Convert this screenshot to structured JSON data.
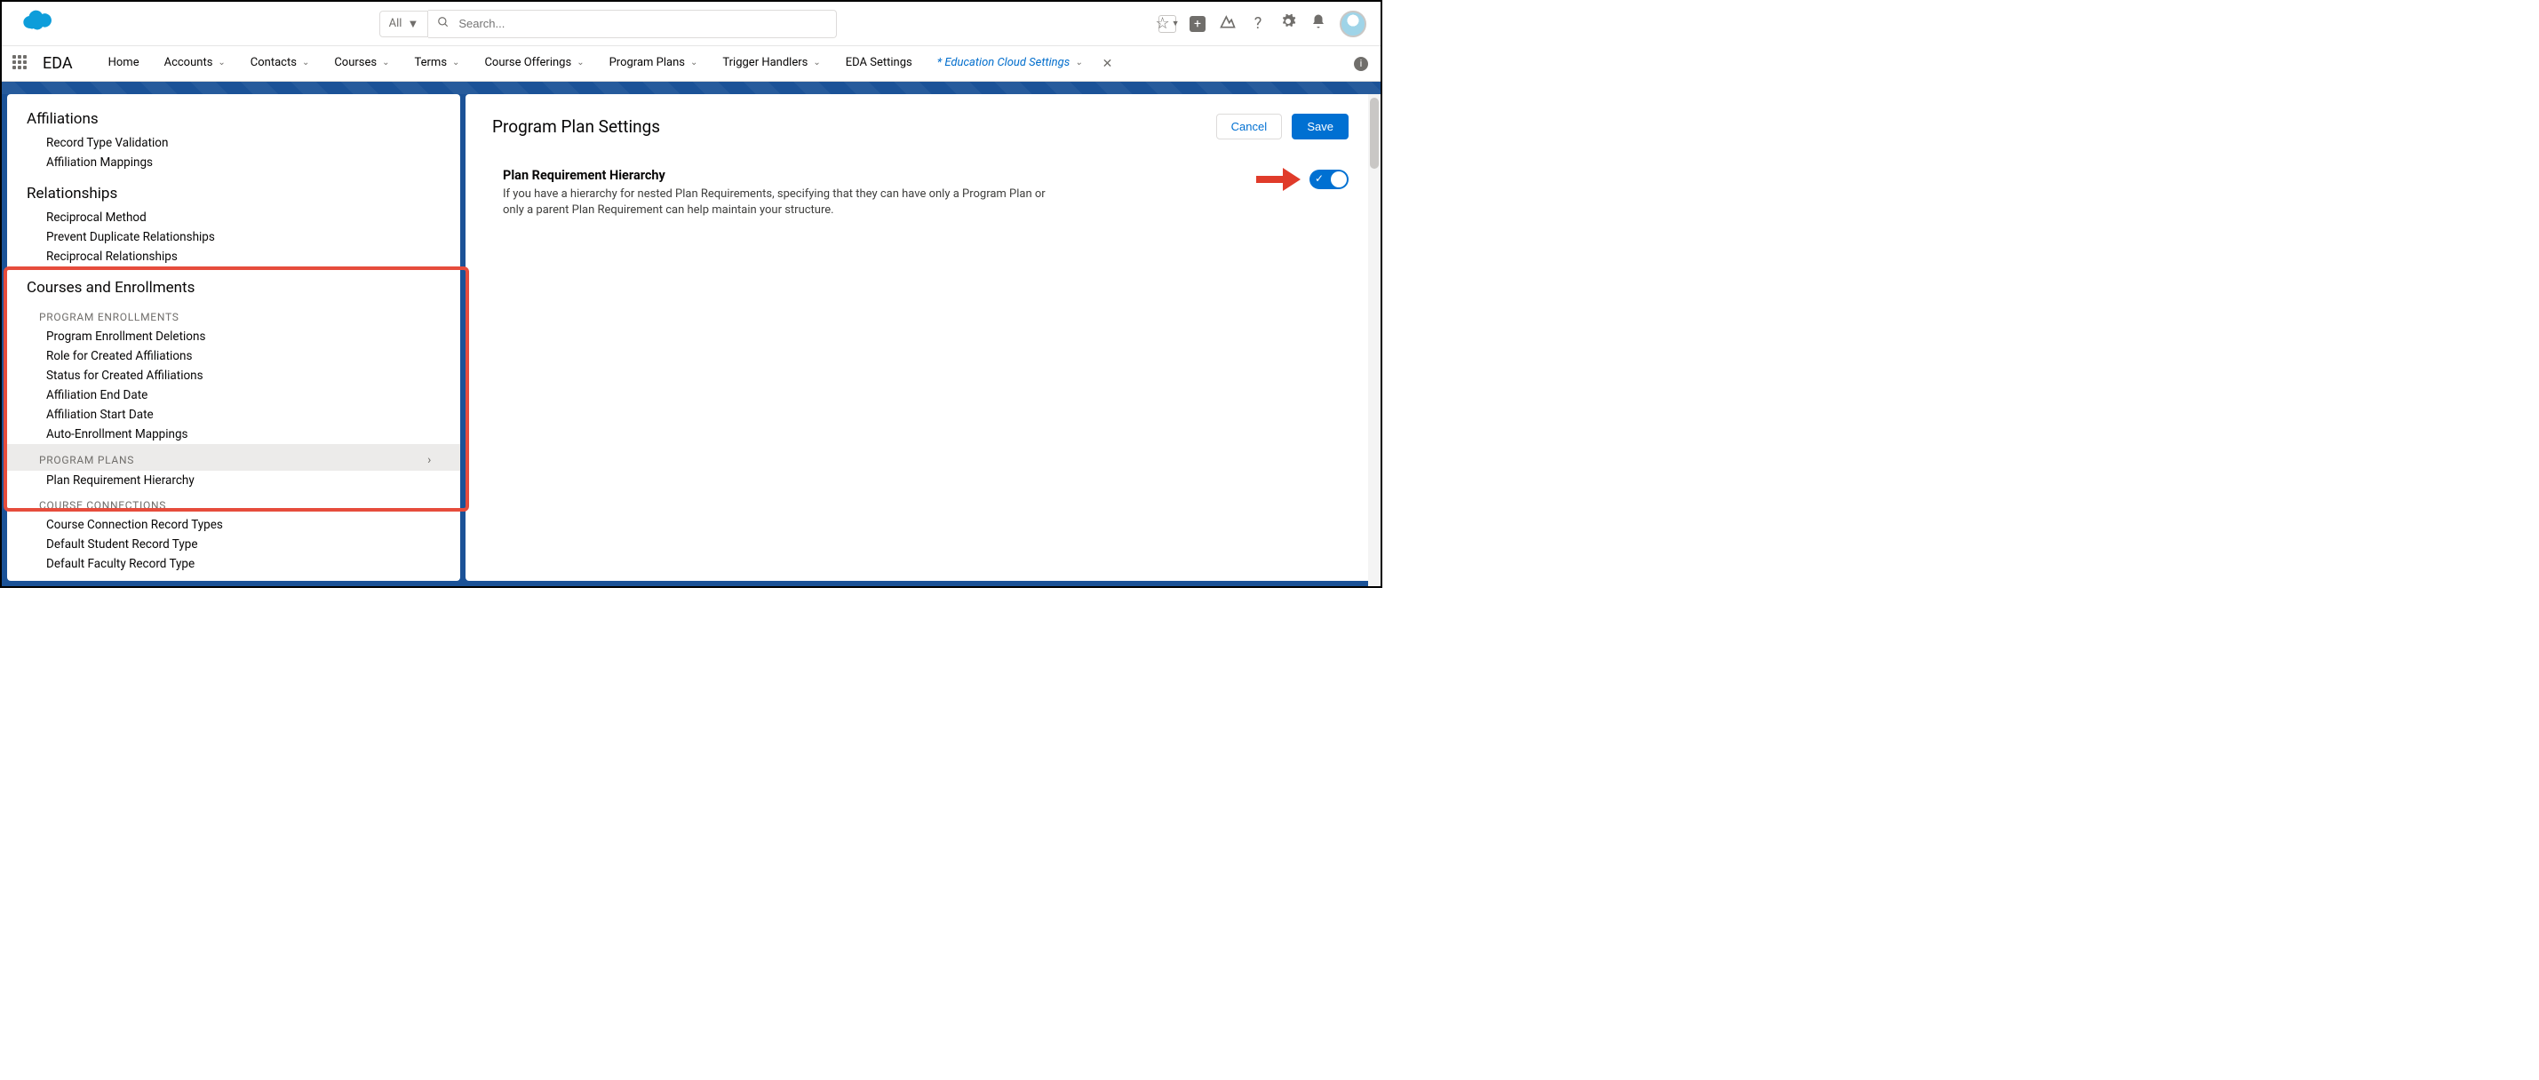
{
  "header": {
    "search_scope": "All",
    "search_placeholder": "Search..."
  },
  "nav": {
    "app_name": "EDA",
    "items": [
      {
        "label": "Home",
        "dropdown": false
      },
      {
        "label": "Accounts",
        "dropdown": true
      },
      {
        "label": "Contacts",
        "dropdown": true
      },
      {
        "label": "Courses",
        "dropdown": true
      },
      {
        "label": "Terms",
        "dropdown": true
      },
      {
        "label": "Course Offerings",
        "dropdown": true
      },
      {
        "label": "Program Plans",
        "dropdown": true
      },
      {
        "label": "Trigger Handlers",
        "dropdown": true
      },
      {
        "label": "EDA Settings",
        "dropdown": false
      },
      {
        "label": "* Education Cloud Settings",
        "dropdown": true,
        "active": true,
        "closable": true
      }
    ]
  },
  "sidebar": {
    "sections": [
      {
        "title": "Affiliations",
        "items": [
          "Record Type Validation",
          "Affiliation Mappings"
        ]
      },
      {
        "title": "Relationships",
        "items": [
          "Reciprocal Method",
          "Prevent Duplicate Relationships",
          "Reciprocal Relationships"
        ]
      },
      {
        "title": "Courses and Enrollments",
        "groups": [
          {
            "subhead": "PROGRAM ENROLLMENTS",
            "items": [
              "Program Enrollment Deletions",
              "Role for Created Affiliations",
              "Status for Created Affiliations",
              "Affiliation End Date",
              "Affiliation Start Date",
              "Auto-Enrollment Mappings"
            ]
          },
          {
            "subhead": "PROGRAM PLANS",
            "selected": true,
            "items": [
              "Plan Requirement Hierarchy"
            ]
          },
          {
            "subhead": "COURSE CONNECTIONS",
            "items": [
              "Course Connection Record Types",
              "Default Student Record Type",
              "Default Faculty Record Type"
            ]
          }
        ]
      }
    ]
  },
  "main": {
    "title": "Program Plan Settings",
    "cancel": "Cancel",
    "save": "Save",
    "setting_label": "Plan Requirement Hierarchy",
    "setting_desc": "If you have a hierarchy for nested Plan Requirements, specifying that they can have only a Program Plan or only a parent Plan Requirement can help maintain your structure.",
    "toggle_on": true
  }
}
